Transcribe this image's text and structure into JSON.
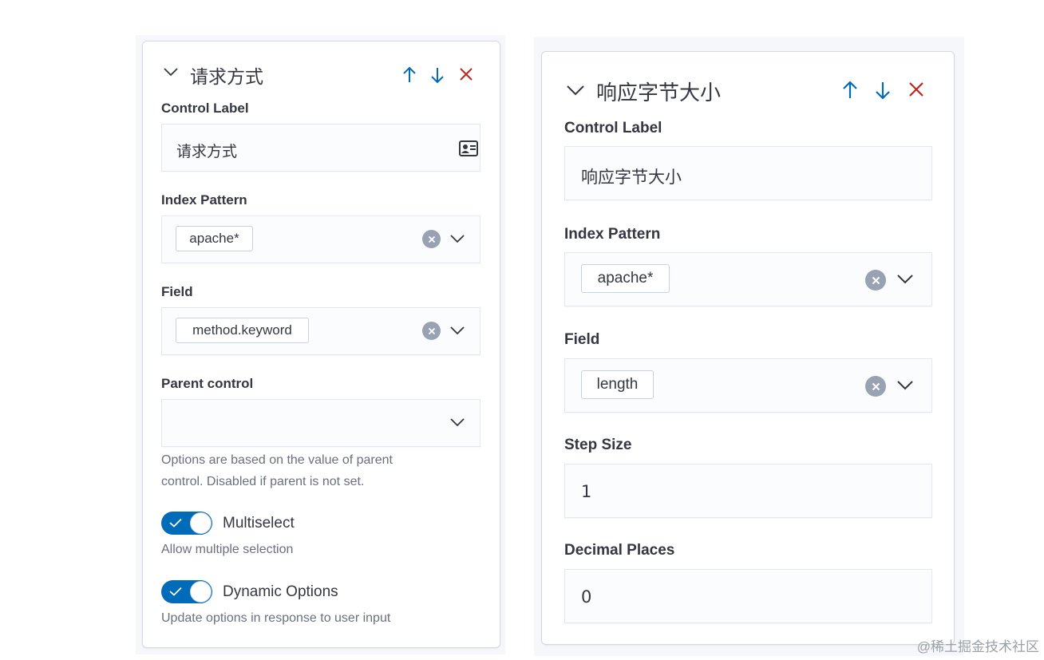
{
  "left_panel": {
    "title": "请求方式",
    "control_label": {
      "label": "Control Label",
      "value": "请求方式"
    },
    "index_pattern": {
      "label": "Index Pattern",
      "value": "apache*"
    },
    "field": {
      "label": "Field",
      "value": "method.keyword"
    },
    "parent_control": {
      "label": "Parent control",
      "value": "",
      "help_line1": "Options are based on the value of parent",
      "help_line2": "control. Disabled if parent is not set."
    },
    "multiselect": {
      "label": "Multiselect",
      "help": "Allow multiple selection",
      "on": true
    },
    "dynamic_options": {
      "label": "Dynamic Options",
      "help": "Update options in response to user input",
      "on": true
    }
  },
  "right_panel": {
    "title": "响应字节大小",
    "control_label": {
      "label": "Control Label",
      "value": "响应字节大小"
    },
    "index_pattern": {
      "label": "Index Pattern",
      "value": "apache*"
    },
    "field": {
      "label": "Field",
      "value": "length"
    },
    "step_size": {
      "label": "Step Size",
      "value": "1"
    },
    "decimal_places": {
      "label": "Decimal Places",
      "value": "0"
    }
  },
  "watermark": "@稀土掘金技术社区",
  "colors": {
    "accent": "#006bb8",
    "danger": "#bd271e",
    "text": "#343741",
    "subdued": "#69707d",
    "clear_icon": "#98a2b3"
  }
}
